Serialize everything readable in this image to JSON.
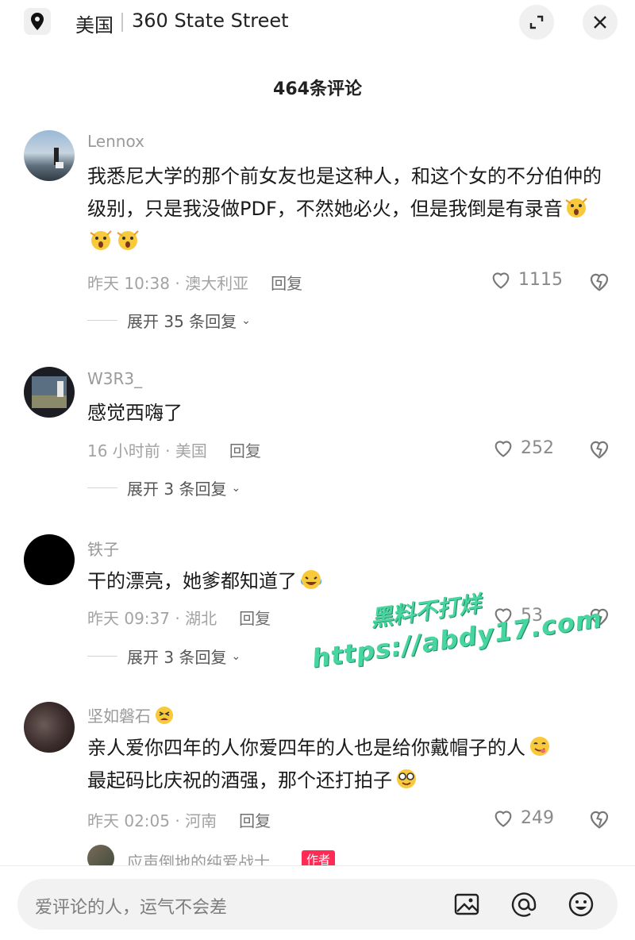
{
  "header": {
    "country": "美国",
    "street": "360 State Street"
  },
  "comments_count": "464条评论",
  "comments": [
    {
      "username": "Lennox",
      "text": "我悉尼大学的那个前女友也是这种人，和这个女的不分伯仲的级别，只是我没做PDF，不然她必火，但是我倒是有录音",
      "time_location": "昨天 10:38 · 澳大利亚",
      "reply_label": "回复",
      "likes": "1115",
      "expand_label": "展开 35 条回复"
    },
    {
      "username": "W3R3_",
      "text": "感觉西嗨了",
      "time_location": "16 小时前 · 美国",
      "reply_label": "回复",
      "likes": "252",
      "expand_label": "展开 3 条回复"
    },
    {
      "username": "铁子",
      "text": "干的漂亮，她爹都知道了",
      "time_location": "昨天 09:37 · 湖北",
      "reply_label": "回复",
      "likes": "53",
      "expand_label": "展开 3 条回复"
    },
    {
      "username": "坚如磐石",
      "text_line1": "亲人爱你四年的人你爱四年的人也是给你戴帽子的人",
      "text_line2": "最起码比庆祝的酒强，那个还打拍子",
      "time_location": "昨天 02:05 · 河南",
      "reply_label": "回复",
      "likes": "249"
    }
  ],
  "sub_reply": {
    "username": "应声倒地的纯爱战士",
    "badge": "作者"
  },
  "input": {
    "placeholder": "爱评论的人，运气不会差"
  },
  "watermark": {
    "line1": "黑料不打烊",
    "line2": "https://abdy17.com"
  },
  "colors": {
    "author_badge": "#fe2c55",
    "watermark": "#47d6a0"
  },
  "icons": [
    "location-pin-icon",
    "expand-icon",
    "close-icon",
    "heart-icon",
    "dislike-heart-icon",
    "image-icon",
    "at-icon",
    "emoji-icon"
  ]
}
